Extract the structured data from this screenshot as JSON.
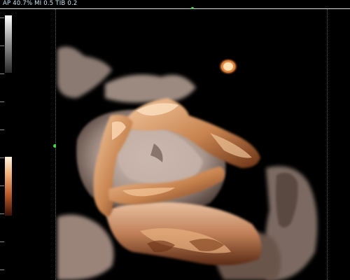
{
  "header": {
    "status_text": "AP 40.7%  MI 0.5 TIB 0.2"
  },
  "image": {
    "icon": "ultrasound-3d-render-image",
    "subject": "3D ultrasound surface rendering",
    "palette": {
      "background": "#000000",
      "highlight": "#f2c79b",
      "midtone": "#c07a45",
      "shadow": "#5a2a12",
      "tissue_grey": "#b8aaa2"
    }
  },
  "overlays": {
    "marker_color": "#46d846",
    "line_color": "#dcdcdc"
  },
  "scales": {
    "grey_map_icon": "grayscale-map-bar",
    "color_map_icon": "sepia-color-map-bar"
  }
}
